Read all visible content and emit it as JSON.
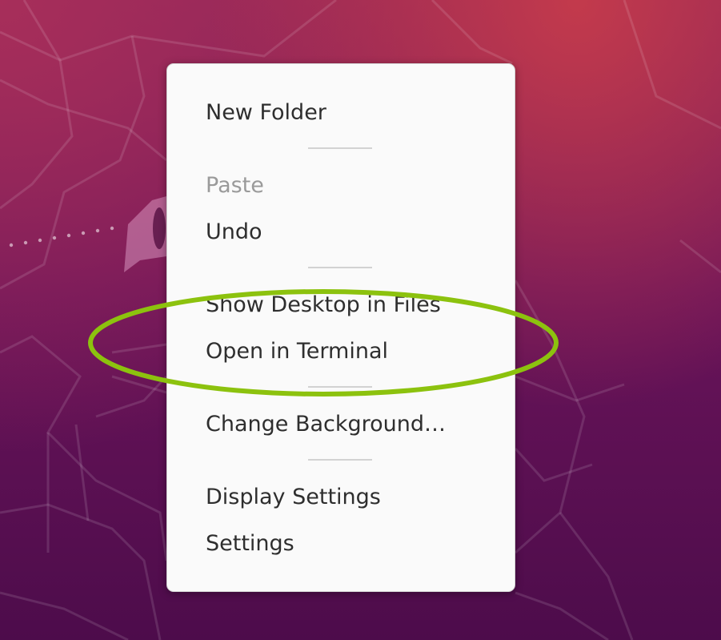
{
  "context_menu": {
    "items": [
      {
        "label": "New Folder",
        "enabled": true
      },
      {
        "label": "Paste",
        "enabled": false
      },
      {
        "label": "Undo",
        "enabled": true
      },
      {
        "label": "Show Desktop in Files",
        "enabled": true
      },
      {
        "label": "Open in Terminal",
        "enabled": true
      },
      {
        "label": "Change Background…",
        "enabled": true
      },
      {
        "label": "Display Settings",
        "enabled": true
      },
      {
        "label": "Settings",
        "enabled": true
      }
    ]
  },
  "colors": {
    "highlight_ellipse": "#8cc20e",
    "menu_background": "#fafafa",
    "menu_text": "#2e2e2e",
    "menu_text_disabled": "#9a9a9a",
    "wallpaper_top": "#8c2459",
    "wallpaper_bottom": "#4d0c4b"
  },
  "icons": {
    "wallpaper_mascot": "ubuntu-focal-fossa-icon"
  }
}
